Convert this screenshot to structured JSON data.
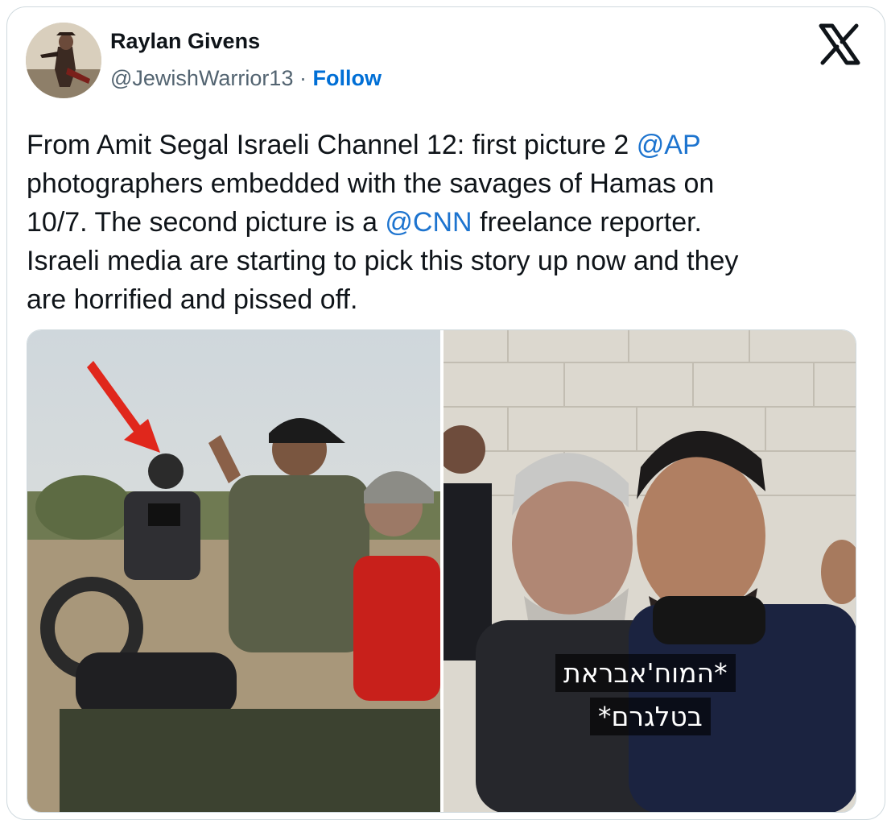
{
  "author": {
    "name": "Raylan Givens",
    "handle": "@JewishWarrior13",
    "separator": "·",
    "follow_label": "Follow"
  },
  "tweet": {
    "line1_a": "From Amit Segal Israeli Channel 12: first picture 2 ",
    "mention_ap": "@AP",
    "line2": "photographers embedded with the savages of Hamas on",
    "line3_a": "10/7. The second picture is a ",
    "mention_cnn": "@CNN",
    "line3_b": " freelance reporter.",
    "line4": "Israeli media are starting to pick this story up now and they",
    "line5": "are horrified and pissed off."
  },
  "media": {
    "caption_line1": "*המוח'אבראת",
    "caption_line2": "בטלגרם*"
  },
  "icons": {
    "platform_logo": "x-logo-icon",
    "arrow": "red-arrow-icon"
  },
  "colors": {
    "link": "#1d74cf",
    "follow": "#006fd6",
    "text": "#0f1419",
    "secondary": "#536471"
  }
}
